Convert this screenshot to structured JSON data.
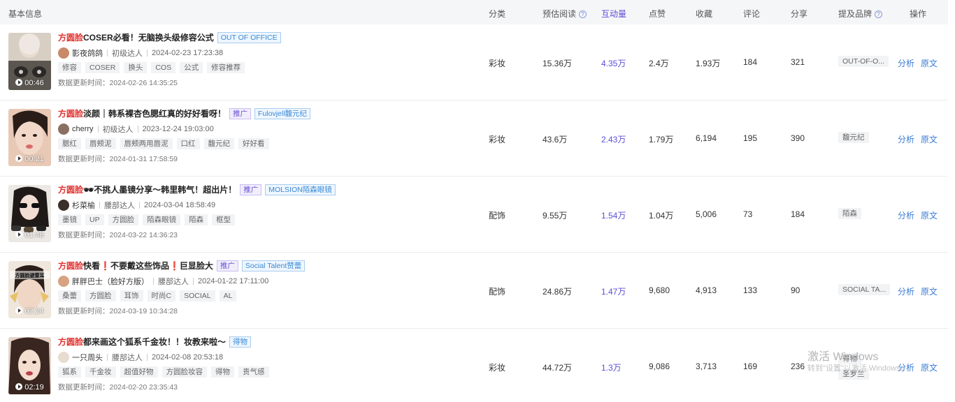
{
  "columns": {
    "basic": "基本信息",
    "category": "分类",
    "reads": "预估阅读",
    "interact": "互动量",
    "likes": "点赞",
    "favs": "收藏",
    "comments": "评论",
    "shares": "分享",
    "brands": "提及品牌",
    "ops": "操作"
  },
  "ops": {
    "analyze": "分析",
    "original": "原文"
  },
  "rows": [
    {
      "keyword": "方圆脸",
      "title": "COSER必看！无脑换头级修容公式",
      "promo": "",
      "brand_badge": "OUT OF OFFICE",
      "author": "影夜鸽鸽",
      "level": "初级达人",
      "time": "2024-02-23 17:23:38",
      "tags": [
        "修容",
        "COSER",
        "换头",
        "COS",
        "公式",
        "修容推荐"
      ],
      "update_label": "数据更新时间：",
      "update_time": "2024-02-26 14:35:25",
      "duration": "00:46",
      "category": "彩妆",
      "reads": "15.36万",
      "interact": "4.35万",
      "likes": "2.4万",
      "favs": "1.93万",
      "comments": "184",
      "shares": "321",
      "brand": "OUT-OF-O..."
    },
    {
      "keyword": "方圆脸",
      "title": "淡颜｜韩系裸杏色腮红真的好好看呀！",
      "promo": "推广",
      "brand_badge": "Fulovjell馥元纪",
      "author": "cherry",
      "level": "初级达人",
      "time": "2023-12-24 19:03:00",
      "tags": [
        "腮红",
        "唇颊泥",
        "唇颊两用唇泥",
        "口红",
        "馥元纪",
        "好好看"
      ],
      "update_label": "数据更新时间：",
      "update_time": "2024-01-31 17:58:59",
      "duration": "00:21",
      "category": "彩妆",
      "reads": "43.6万",
      "interact": "2.43万",
      "likes": "1.79万",
      "favs": "6,194",
      "comments": "195",
      "shares": "390",
      "brand": "馥元纪"
    },
    {
      "keyword": "方圆脸",
      "title": "🕶不挑人墨镜分享～韩里韩气！超出片！",
      "promo": "推广",
      "brand_badge": "MOLSION陌森眼镜",
      "author": "杉菜榆",
      "level": "腰部达人",
      "time": "2024-03-04 18:58:49",
      "tags": [
        "墨镜",
        "UP",
        "方圆脸",
        "陌森眼镜",
        "陌森",
        "框型"
      ],
      "update_label": "数据更新时间：",
      "update_time": "2024-03-22 14:36:23",
      "duration": "01:46",
      "category": "配饰",
      "reads": "9.55万",
      "interact": "1.54万",
      "likes": "1.04万",
      "favs": "5,006",
      "comments": "73",
      "shares": "184",
      "brand": "陌森"
    },
    {
      "keyword": "方圆脸",
      "title": "快看❗不要戴这些饰品❗巨显脸大",
      "promo": "推广",
      "brand_badge": "Social Talent赞蕾",
      "author": "胖胖巴士（脸好方版）",
      "level": "腰部达人",
      "time": "2024-01-22 17:11:00",
      "tags": [
        "桑蕾",
        "方圆脸",
        "耳饰",
        "时尚C",
        "SOCIAL",
        "AL"
      ],
      "update_label": "数据更新时间：",
      "update_time": "2024-03-19 10:34:28",
      "duration": "02:24",
      "thumb_text": "方圆脸避雷耳",
      "category": "配饰",
      "reads": "24.86万",
      "interact": "1.47万",
      "likes": "9,680",
      "favs": "4,913",
      "comments": "133",
      "shares": "90",
      "brand": "SOCIAL TA..."
    },
    {
      "keyword": "方圆脸",
      "title": "都来画这个狐系千金妆！！妆教来啦～",
      "promo": "",
      "brand_badge": "得物",
      "author": "一只周头",
      "level": "腰部达人",
      "time": "2024-02-08 20:53:18",
      "tags": [
        "狐系",
        "千金妆",
        "超值好物",
        "方圆脸妆容",
        "得物",
        "贵气感"
      ],
      "update_label": "数据更新时间：",
      "update_time": "2024-02-20 23:35:43",
      "duration": "02:19",
      "category": "彩妆",
      "reads": "44.72万",
      "interact": "1.3万",
      "likes": "9,086",
      "favs": "3,713",
      "comments": "169",
      "shares": "236",
      "brand": "得物",
      "brand2": "圣罗兰"
    }
  ],
  "watermark": {
    "title": "激活 Windows",
    "subtitle": "转到\"设置\"以激活 Windows。"
  }
}
